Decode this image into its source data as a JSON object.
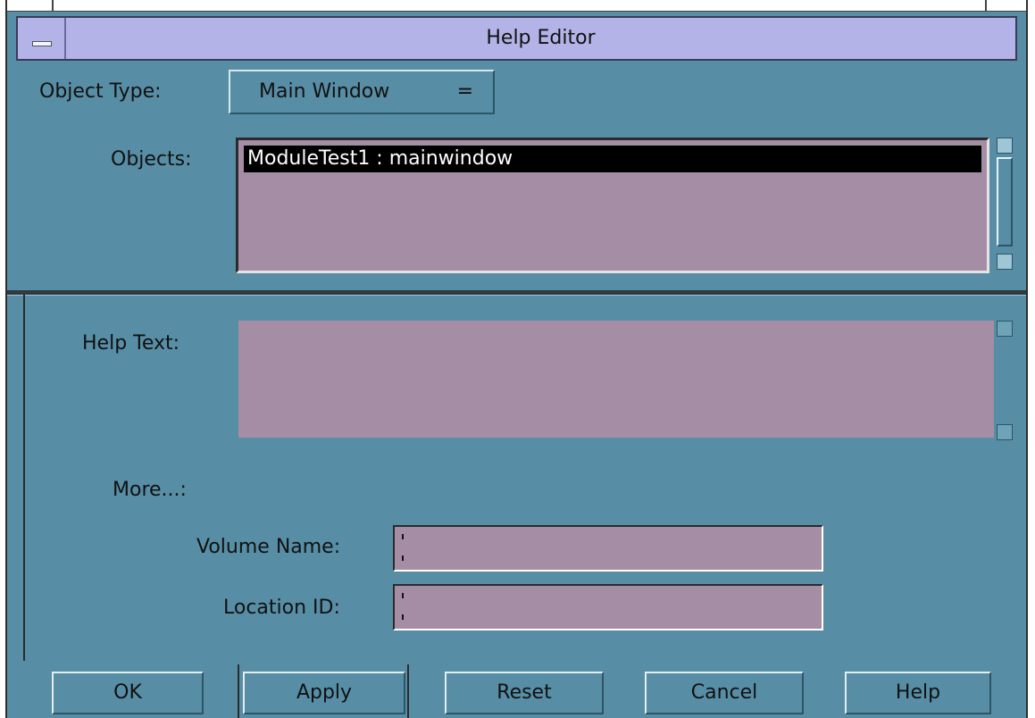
{
  "window": {
    "title": "Help Editor"
  },
  "object_type": {
    "label": "Object Type:",
    "value": "Main Window",
    "indicator": "="
  },
  "objects": {
    "label": "Objects:",
    "items": [
      "ModuleTest1 : mainwindow"
    ],
    "selected_index": 0
  },
  "help_text": {
    "label": "Help Text:",
    "value": ""
  },
  "more": {
    "label": "More...:",
    "volume_name": {
      "label": "Volume Name:",
      "value": ""
    },
    "location_id": {
      "label": "Location ID:",
      "value": ""
    }
  },
  "buttons": {
    "ok": "OK",
    "apply": "Apply",
    "reset": "Reset",
    "cancel": "Cancel",
    "help": "Help"
  },
  "colors": {
    "background": "#578ea5",
    "titlebar": "#b3b3e7",
    "field": "#a58ea5",
    "selection": "#000000"
  }
}
